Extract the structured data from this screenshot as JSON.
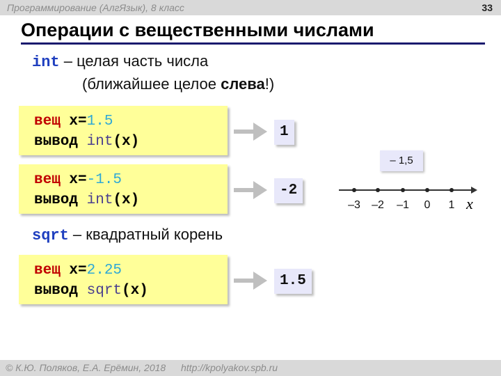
{
  "header": {
    "course": "Программирование (АлгЯзык), 8 класс",
    "page_number": "33"
  },
  "title": "Операции с вещественными числами",
  "int_desc": {
    "keyword": "int",
    "text": " – целая часть числа",
    "line2_prefix": "(ближайшее целое ",
    "line2_bold": "слева",
    "line2_suffix": "!)"
  },
  "sqrt_desc": {
    "keyword": "sqrt",
    "text": " – квадратный корень"
  },
  "examples": [
    {
      "decl_kw": "вещ",
      "var": " x=",
      "value": "1.5",
      "out_kw": "вывод",
      "func": "int",
      "arg": "(x)",
      "result": "1"
    },
    {
      "decl_kw": "вещ",
      "var": " x=",
      "value": "-1.5",
      "out_kw": "вывод",
      "func": "int",
      "arg": "(x)",
      "result": "-2"
    },
    {
      "decl_kw": "вещ",
      "var": " x=",
      "value": "2.25",
      "out_kw": "вывод",
      "func": "sqrt",
      "arg": "(x)",
      "result": "1.5"
    }
  ],
  "number_line": {
    "callout": "– 1,5",
    "ticks": [
      "–3",
      "–2",
      "–1",
      "0",
      "1"
    ],
    "axis_label": "x"
  },
  "footer": {
    "copyright": "© К.Ю. Поляков, Е.А. Ерёмин, 2018",
    "url": "http://kpolyakov.spb.ru"
  }
}
